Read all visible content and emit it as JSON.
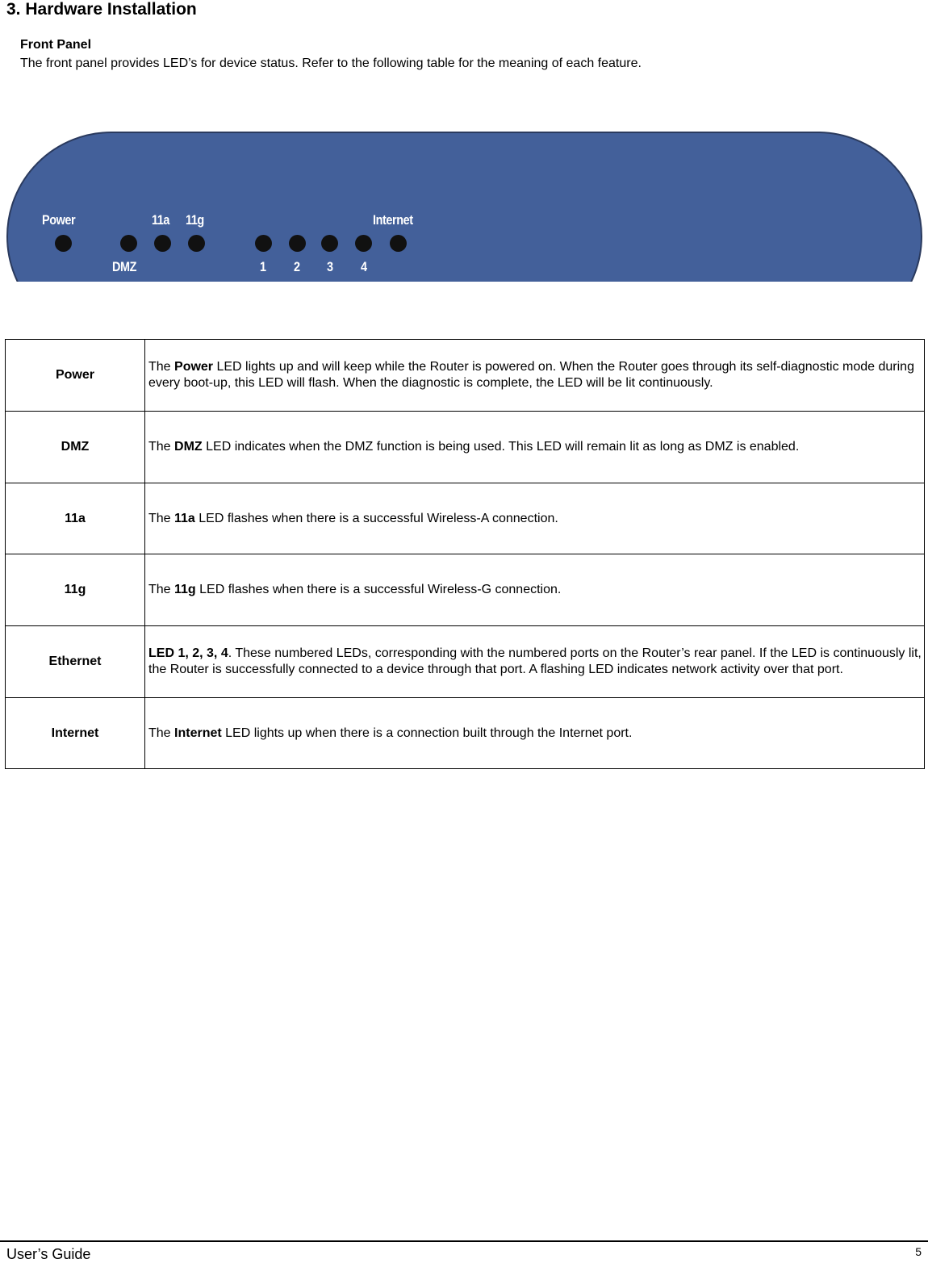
{
  "page": {
    "title": "3. Hardware Installation",
    "section_heading": "Front Panel",
    "intro": "The front panel provides LED’s for device status. Refer to the following table for the meaning of each feature."
  },
  "front_panel_image": {
    "panel_color": "#43609a",
    "labels": {
      "power": "Power",
      "dmz": "DMZ",
      "a11": "11a",
      "g11": "11g",
      "internet": "Internet",
      "port1": "1",
      "port2": "2",
      "port3": "3",
      "port4": "4"
    }
  },
  "led_table": {
    "rows": [
      {
        "name": "Power",
        "pre": "The ",
        "bold": "Power",
        "post": " LED lights up and will keep while the Router is powered on. When the Router goes through its self-diagnostic mode during every boot-up, this LED will flash. When the diagnostic is complete, the LED will be lit continuously."
      },
      {
        "name": "DMZ",
        "pre": "The ",
        "bold": "DMZ",
        "post": " LED indicates when the DMZ function is being used. This LED will remain lit as long as DMZ is enabled."
      },
      {
        "name": "11a",
        "pre": "The ",
        "bold": "11a",
        "post": " LED flashes when there is a successful Wireless-A connection."
      },
      {
        "name": "11g",
        "pre": "The ",
        "bold": "11g",
        "post": " LED flashes when there is a successful Wireless-G connection."
      },
      {
        "name": "Ethernet",
        "pre": "",
        "bold": "LED 1, 2, 3, 4",
        "post": ". These numbered LEDs, corresponding with the numbered ports on the Router’s rear panel. If the LED is continuously lit, the Router is successfully connected to a device through that port. A flashing LED indicates network activity over that port."
      },
      {
        "name": "Internet",
        "pre": "The ",
        "bold": "Internet",
        "post": " LED lights up when there is a connection built through the Internet port."
      }
    ]
  },
  "footer": {
    "left": "User’s Guide",
    "page_number": "5"
  }
}
